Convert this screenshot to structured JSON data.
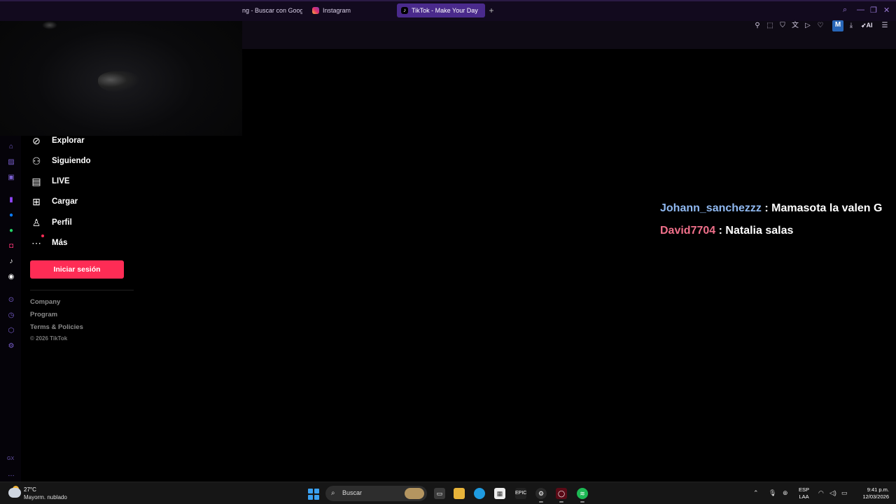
{
  "browser": {
    "tabs": [
      {
        "label": "ng - Buscar con Goog",
        "active": false
      },
      {
        "label": "Instagram",
        "active": false
      },
      {
        "label": "TikTok - Make Your Day",
        "active": true
      }
    ],
    "new_tab": "+",
    "toolbar": {
      "ai_label": "AI",
      "profile_initial": "M"
    },
    "accent": "#4a2a8c"
  },
  "gx_sidebar": {
    "label": "GX",
    "icons": [
      "aria-icon",
      "gxcorner-icon",
      "player-icon",
      "twitch-icon",
      "messenger-icon",
      "whatsapp-icon",
      "instagram-icon",
      "tiktok-icon",
      "discord-icon",
      "speed-dial-icon",
      "history-icon",
      "extensions-icon",
      "settings-icon",
      "more-icon"
    ]
  },
  "tiktok": {
    "nav": [
      {
        "id": "explore",
        "label": "Explorar",
        "icon": "compass-icon"
      },
      {
        "id": "following",
        "label": "Siguiendo",
        "icon": "user-follow-icon"
      },
      {
        "id": "live",
        "label": "LIVE",
        "icon": "live-tv-icon"
      },
      {
        "id": "upload",
        "label": "Cargar",
        "icon": "plus-square-icon"
      },
      {
        "id": "profile",
        "label": "Perfil",
        "icon": "person-icon"
      },
      {
        "id": "more",
        "label": "Más",
        "icon": "more-dots-icon"
      }
    ],
    "login_label": "Iniciar sesión",
    "footer_links": [
      "Company",
      "Program",
      "Terms & Policies"
    ],
    "copyright": "© 2026 TikTok",
    "brand_color": "#fe2c55"
  },
  "chat": [
    {
      "user": "Johann_sanchezzz",
      "separator": ":",
      "message": "Mamasota la valen G",
      "color": "#8fb8f0"
    },
    {
      "user": "David7704",
      "separator": ":",
      "message": "Natalia salas",
      "color": "#f0708a"
    }
  ],
  "taskbar": {
    "weather": {
      "temp": "27°C",
      "condition": "Mayorm. nublado"
    },
    "search_placeholder": "Buscar",
    "language": {
      "line1": "ESP",
      "line2": "LAA"
    },
    "clock": {
      "time": "9:41 p.m.",
      "date": "12/03/2026"
    },
    "apps": [
      "windows-start-icon",
      "file-explorer-icon",
      "folder-icon",
      "edge-icon",
      "store-icon",
      "epic-games-icon",
      "steam-icon",
      "opera-gx-icon",
      "spotify-icon"
    ]
  }
}
